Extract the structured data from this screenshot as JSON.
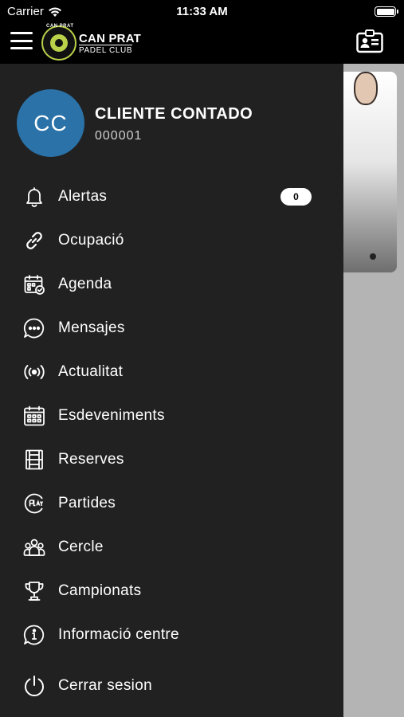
{
  "status_bar": {
    "carrier": "Carrier",
    "time": "11:33 AM"
  },
  "header": {
    "logo_top": "CAN PRAT",
    "logo_title": "CAN PRAT",
    "logo_subtitle": "PADEL CLUB"
  },
  "user": {
    "initials": "CC",
    "name": "CLIENTE CONTADO",
    "code": "000001"
  },
  "menu": [
    {
      "label": "Alertas",
      "icon": "bell-icon",
      "badge": "0"
    },
    {
      "label": "Ocupació",
      "icon": "link-icon"
    },
    {
      "label": "Agenda",
      "icon": "calendar-check-icon"
    },
    {
      "label": "Mensajes",
      "icon": "chat-bubble-icon"
    },
    {
      "label": "Actualitat",
      "icon": "broadcast-icon"
    },
    {
      "label": "Esdeveniments",
      "icon": "calendar-grid-icon"
    },
    {
      "label": "Reserves",
      "icon": "court-icon"
    },
    {
      "label": "Partides",
      "icon": "play-icon"
    },
    {
      "label": "Cercle",
      "icon": "group-icon"
    },
    {
      "label": "Campionats",
      "icon": "trophy-icon"
    },
    {
      "label": "Informació centre",
      "icon": "info-icon"
    },
    {
      "label": "Cerrar sesion",
      "icon": "power-icon"
    }
  ],
  "colors": {
    "drawer_bg": "#212121",
    "avatar_bg": "#2a72a8",
    "logo_accent": "#b9d24a"
  }
}
